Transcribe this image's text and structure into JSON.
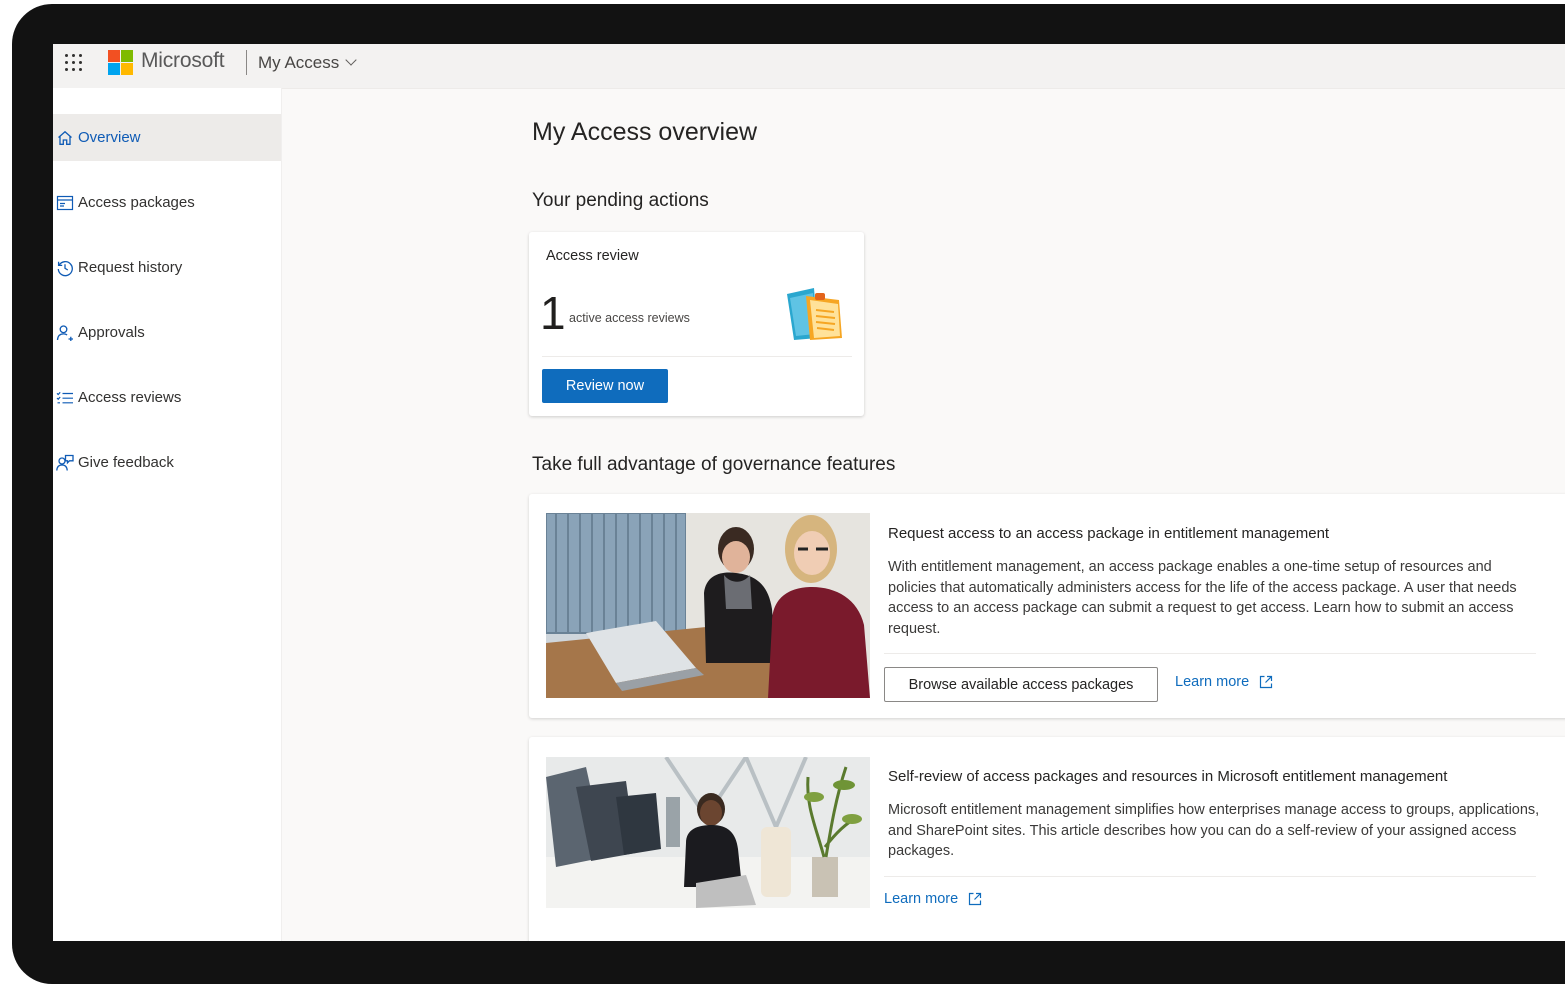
{
  "header": {
    "brand": "Microsoft",
    "app_name": "My Access"
  },
  "sidebar": {
    "items": [
      {
        "label": "Overview",
        "icon": "home-icon",
        "active": true
      },
      {
        "label": "Access packages",
        "icon": "package-icon"
      },
      {
        "label": "Request history",
        "icon": "history-icon"
      },
      {
        "label": "Approvals",
        "icon": "person-approval-icon"
      },
      {
        "label": "Access reviews",
        "icon": "checklist-icon"
      },
      {
        "label": "Give feedback",
        "icon": "feedback-icon"
      }
    ]
  },
  "main": {
    "title": "My Access overview",
    "pending_title": "Your pending actions",
    "pending_card": {
      "title": "Access review",
      "count": "1",
      "count_label": "active access reviews",
      "button": "Review now"
    },
    "governance_title": "Take full advantage of governance features",
    "features": [
      {
        "title": "Request access to an access package in entitlement management",
        "description": "With entitlement management, an access package enables a one-time setup of resources and policies that automatically administers access for the life of the access package. A user that needs access to an access package can submit a request to get access. Learn how to submit an access request.",
        "button": "Browse available access packages",
        "link": "Learn more"
      },
      {
        "title": "Self-review of access packages and resources in Microsoft entitlement management",
        "description": "Microsoft entitlement management simplifies how enterprises manage access to groups, applications, and SharePoint sites. This article describes how you can do a self-review of your assigned access packages.",
        "link": "Learn more"
      }
    ]
  },
  "colors": {
    "accent": "#0f6cbd",
    "active_nav_text": "#0f5bb5",
    "logo_red": "#f25022",
    "logo_green": "#7fba00",
    "logo_blue": "#00a4ef",
    "logo_yellow": "#ffb900"
  }
}
